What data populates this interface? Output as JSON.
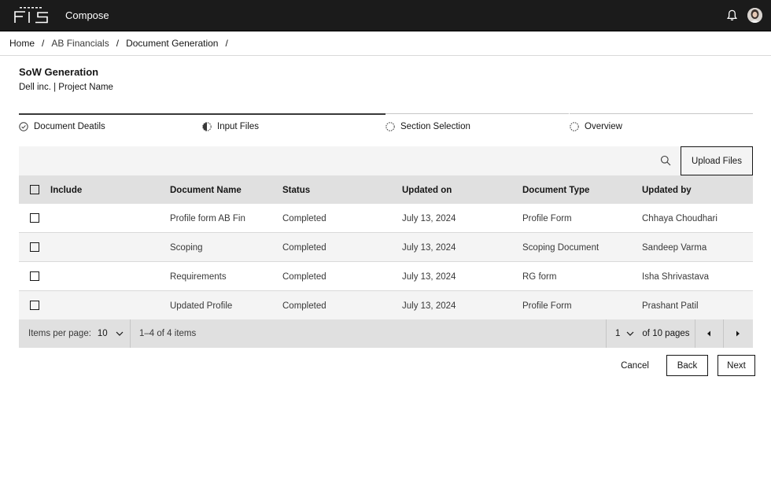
{
  "header": {
    "brand": "FIS",
    "app_name": "Compose",
    "bell_icon": "notification-bell-icon",
    "avatar_icon": "user-avatar"
  },
  "breadcrumb": {
    "items": [
      "Home",
      "AB Financials",
      "Document Generation"
    ],
    "separator": "/"
  },
  "page": {
    "title": "SoW Generation",
    "subtitle": "Dell inc. | Project Name"
  },
  "steps": [
    {
      "label": "Document Deatils",
      "status": "complete",
      "icon": "check-circle-icon"
    },
    {
      "label": "Input Files",
      "status": "current",
      "icon": "half-circle-icon"
    },
    {
      "label": "Section Selection",
      "status": "incomplete",
      "icon": "dashed-circle-icon"
    },
    {
      "label": "Overview",
      "status": "incomplete",
      "icon": "dashed-circle-icon"
    }
  ],
  "toolbar": {
    "search_icon": "search-icon",
    "upload_label": "Upload Files"
  },
  "table": {
    "headers": [
      "Include",
      "Document Name",
      "Status",
      "Updated on",
      "Document Type",
      "Updated by"
    ],
    "rows": [
      {
        "name": "Profile form AB Fin",
        "status": "Completed",
        "updated_on": "July 13, 2024",
        "type": "Profile Form",
        "updated_by": "Chhaya Choudhari"
      },
      {
        "name": "Scoping",
        "status": "Completed",
        "updated_on": "July 13, 2024",
        "type": "Scoping Document",
        "updated_by": "Sandeep Varma"
      },
      {
        "name": "Requirements",
        "status": "Completed",
        "updated_on": "July 13, 2024",
        "type": "RG form",
        "updated_by": "Isha Shrivastava"
      },
      {
        "name": "Updated Profile",
        "status": "Completed",
        "updated_on": "July 13, 2024",
        "type": "Profile Form",
        "updated_by": "Prashant Patil"
      }
    ]
  },
  "pagination": {
    "items_per_page_label": "Items per page:",
    "items_per_page": "10",
    "range": "1–4 of 4 items",
    "page": "1",
    "of_pages": "of 10 pages"
  },
  "footer": {
    "cancel": "Cancel",
    "back": "Back",
    "next": "Next"
  }
}
